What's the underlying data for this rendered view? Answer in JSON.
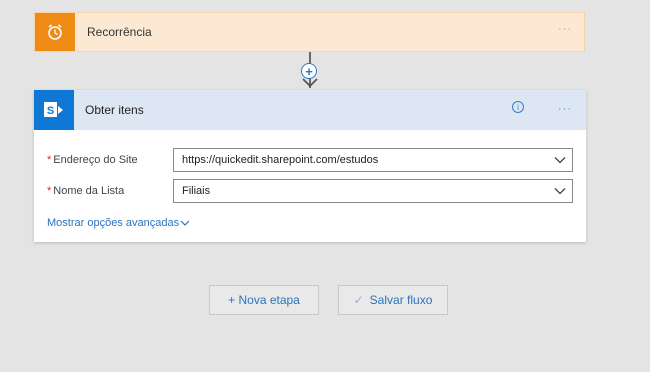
{
  "trigger_card": {
    "title": "Recorrência",
    "icon": "alarm-clock-icon",
    "menu": "···",
    "accent": "#ef8b15"
  },
  "connector": {
    "plus": "+"
  },
  "action_card": {
    "title": "Obter itens",
    "icon": "sharepoint-icon",
    "info": "i",
    "menu": "···",
    "accent": "#0f78d4",
    "fields": [
      {
        "label": "Endereço do Site",
        "required": "*",
        "value": "https://quickedit.sharepoint.com/estudos"
      },
      {
        "label": "Nome da Lista",
        "required": "*",
        "value": "Filiais"
      }
    ],
    "advanced_link": "Mostrar opções avançadas"
  },
  "footer": {
    "new_step": "+ Nova etapa",
    "save_check": "✓",
    "save": "Salvar fluxo"
  }
}
